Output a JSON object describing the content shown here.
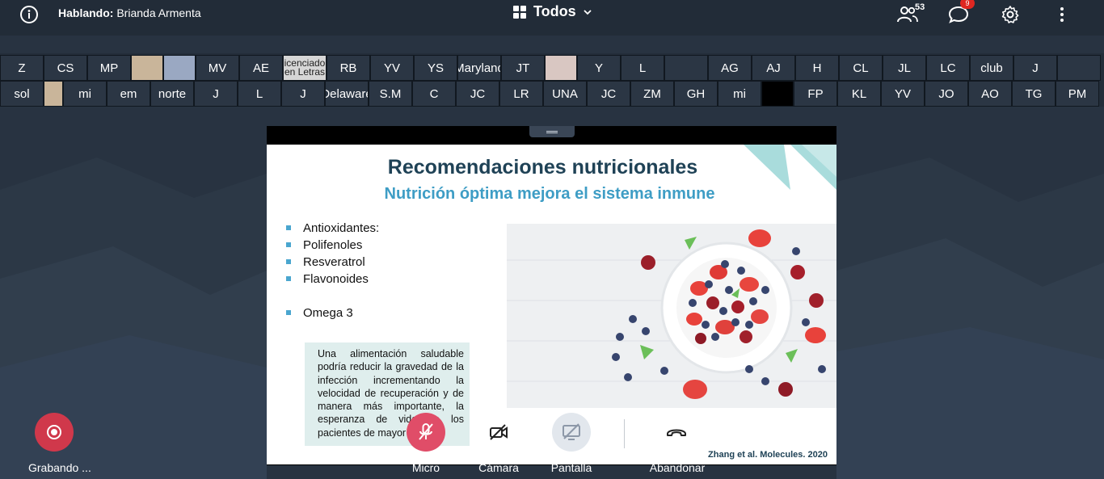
{
  "header": {
    "talking_label": "Hablando:",
    "talking_name": "Brianda Armenta",
    "view_label": "Todos",
    "participants_count": "53",
    "chat_unread": "9"
  },
  "cam_row1": [
    "Z",
    "CS",
    "MP",
    "",
    "",
    "MV",
    "AE",
    "icenciado\nen Letras",
    "RB",
    "YV",
    "YS",
    "Maryland",
    "JT",
    "",
    "Y",
    "L",
    "",
    "AG",
    "AJ",
    "H",
    "CL",
    "JL",
    "LC",
    "club",
    "J",
    ""
  ],
  "cam_row2": [
    "sol",
    "",
    "mi",
    "em",
    "norte",
    "J",
    "L",
    "J",
    "Delaware",
    "S.M",
    "C",
    "JC",
    "LR",
    "UNA",
    "JC",
    "ZM",
    "GH",
    "mi",
    "",
    "FP",
    "KL",
    "YV",
    "JO",
    "AO",
    "TG",
    "PM"
  ],
  "slide": {
    "title": "Recomendaciones nutricionales",
    "subtitle": "Nutrición óptima mejora el sistema inmune",
    "bullets": [
      "Antioxidantes:",
      "Polifenoles",
      "Resveratrol",
      "Flavonoides",
      "Omega 3"
    ],
    "note": "Una alimentación saludable podría reducir la gravedad de la infección incrementando la velocidad de recuperación y de manera más importante, la esperanza de vida de los pacientes de mayor riesgo.",
    "citation": "Zhang et al. Molecules. 2020"
  },
  "controls": {
    "record_label": "Grabando ...",
    "mic_label": "Micro",
    "camera_label": "Cámara",
    "screen_label": "Pantalla",
    "leave_label": "Abandonar"
  },
  "colors": {
    "topbar": "#222c38",
    "background": "#283341",
    "record": "#d0384b",
    "mic_muted": "#e04d68",
    "title": "#1f4256",
    "subtitle": "#3e9dc5"
  }
}
